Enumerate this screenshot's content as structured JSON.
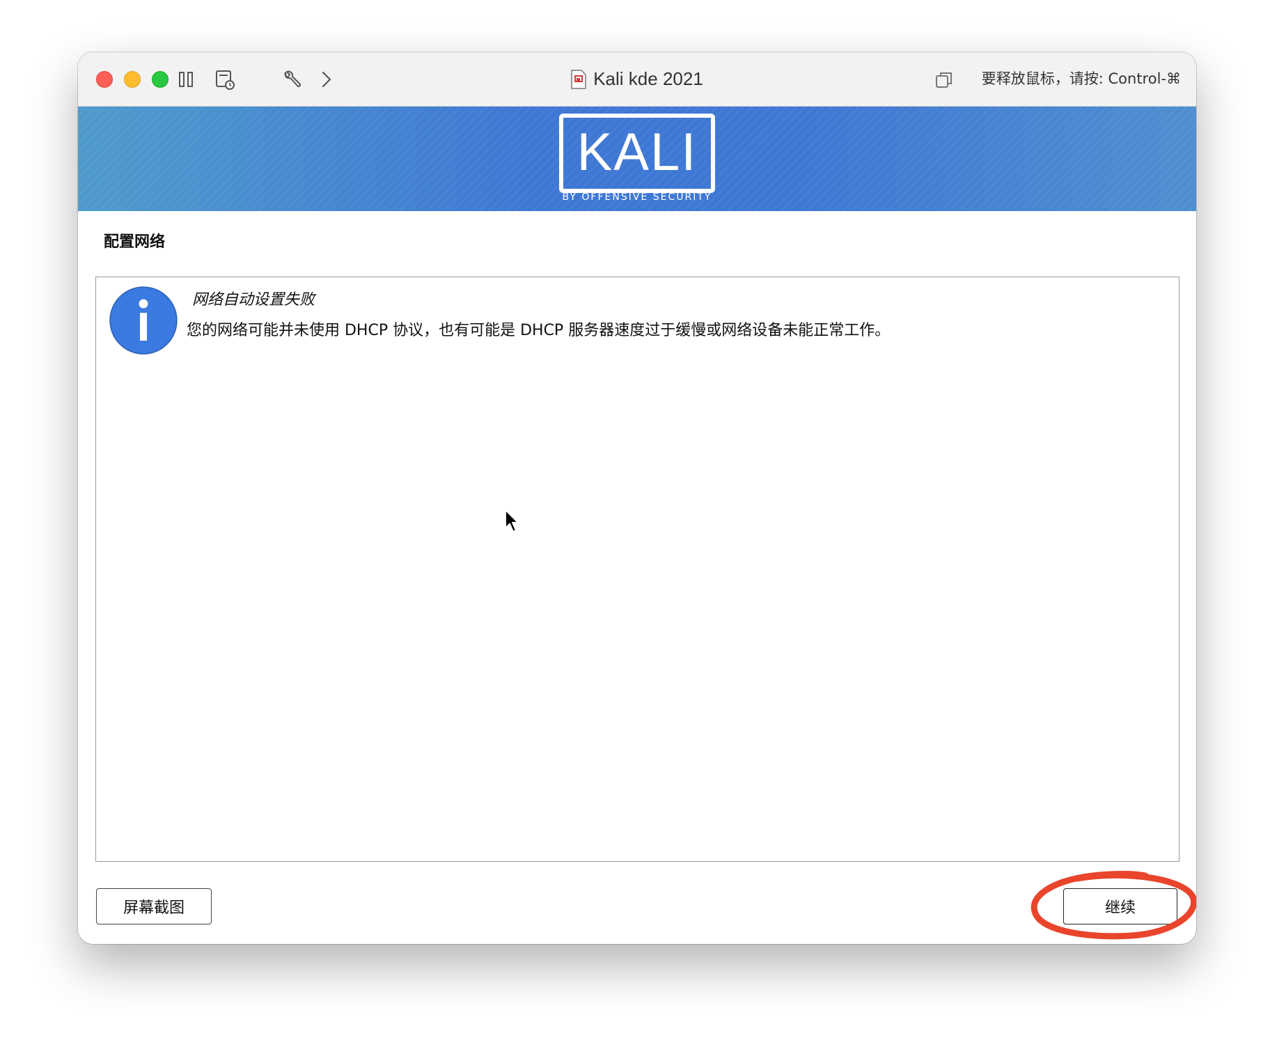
{
  "window": {
    "title": "Kali kde 2021",
    "release_hint": "要释放鼠标，请按: Control-⌘"
  },
  "toolbar": {
    "icons": [
      "pause-icon",
      "snapshot-icon",
      "settings-wrench-icon",
      "forward-chevron-icon",
      "release-mouse-icon"
    ]
  },
  "banner": {
    "logo_text": "KALI",
    "logo_tagline": "BY OFFENSIVE SECURITY"
  },
  "page": {
    "section_title": "配置网络",
    "message": {
      "title": "网络自动设置失败",
      "body": "您的网络可能并未使用 DHCP 协议，也有可能是 DHCP 服务器速度过于缓慢或网络设备未能正常工作。"
    }
  },
  "buttons": {
    "screenshot": "屏幕截图",
    "continue": "继续"
  },
  "colors": {
    "banner": "#3f78d4",
    "info_icon": "#3b7ae0",
    "annotation": "#e8452c"
  }
}
